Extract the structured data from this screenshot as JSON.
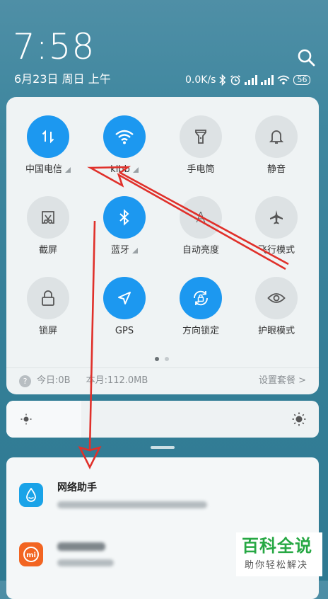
{
  "status": {
    "time": "7:58",
    "date": "6月23日 周日 上午",
    "net_speed": "0.0K/s",
    "battery": "56"
  },
  "tiles": [
    {
      "label": "中国电信",
      "icon": "data-transfer-icon",
      "on": true,
      "has_menu": true
    },
    {
      "label": "klbb",
      "icon": "wifi-icon",
      "on": true,
      "has_menu": true
    },
    {
      "label": "手电筒",
      "icon": "flashlight-icon",
      "on": false,
      "has_menu": false
    },
    {
      "label": "静音",
      "icon": "bell-icon",
      "on": false,
      "has_menu": false
    },
    {
      "label": "截屏",
      "icon": "screenshot-scissors-icon",
      "on": false,
      "has_menu": false
    },
    {
      "label": "蓝牙",
      "icon": "bluetooth-icon",
      "on": true,
      "has_menu": true
    },
    {
      "label": "自动亮度",
      "icon": "auto-brightness-icon",
      "on": false,
      "has_menu": false
    },
    {
      "label": "飞行模式",
      "icon": "airplane-icon",
      "on": false,
      "has_menu": false
    },
    {
      "label": "锁屏",
      "icon": "lock-icon",
      "on": false,
      "has_menu": false
    },
    {
      "label": "GPS",
      "icon": "location-arrow-icon",
      "on": true,
      "has_menu": false
    },
    {
      "label": "方向锁定",
      "icon": "rotation-lock-icon",
      "on": true,
      "has_menu": false
    },
    {
      "label": "护眼模式",
      "icon": "eye-icon",
      "on": false,
      "has_menu": false
    }
  ],
  "pager": {
    "pages": 2,
    "current": 1
  },
  "usage": {
    "today": "今日:0B",
    "month": "本月:112.0MB",
    "plan_link": "设置套餐 >"
  },
  "brightness": {
    "level": 0.24
  },
  "notifications": [
    {
      "title": "网络助手",
      "icon": "water-drop-icon",
      "color": "#1aa3e8"
    },
    {
      "icon": "mi-logo-icon",
      "color": "#f26522"
    }
  ],
  "watermark": {
    "main": "百科全说",
    "sub": "助你轻松解决"
  },
  "colors": {
    "accent": "#1c98f0",
    "arrow": "#e0302a",
    "watermark": "#27a844"
  }
}
